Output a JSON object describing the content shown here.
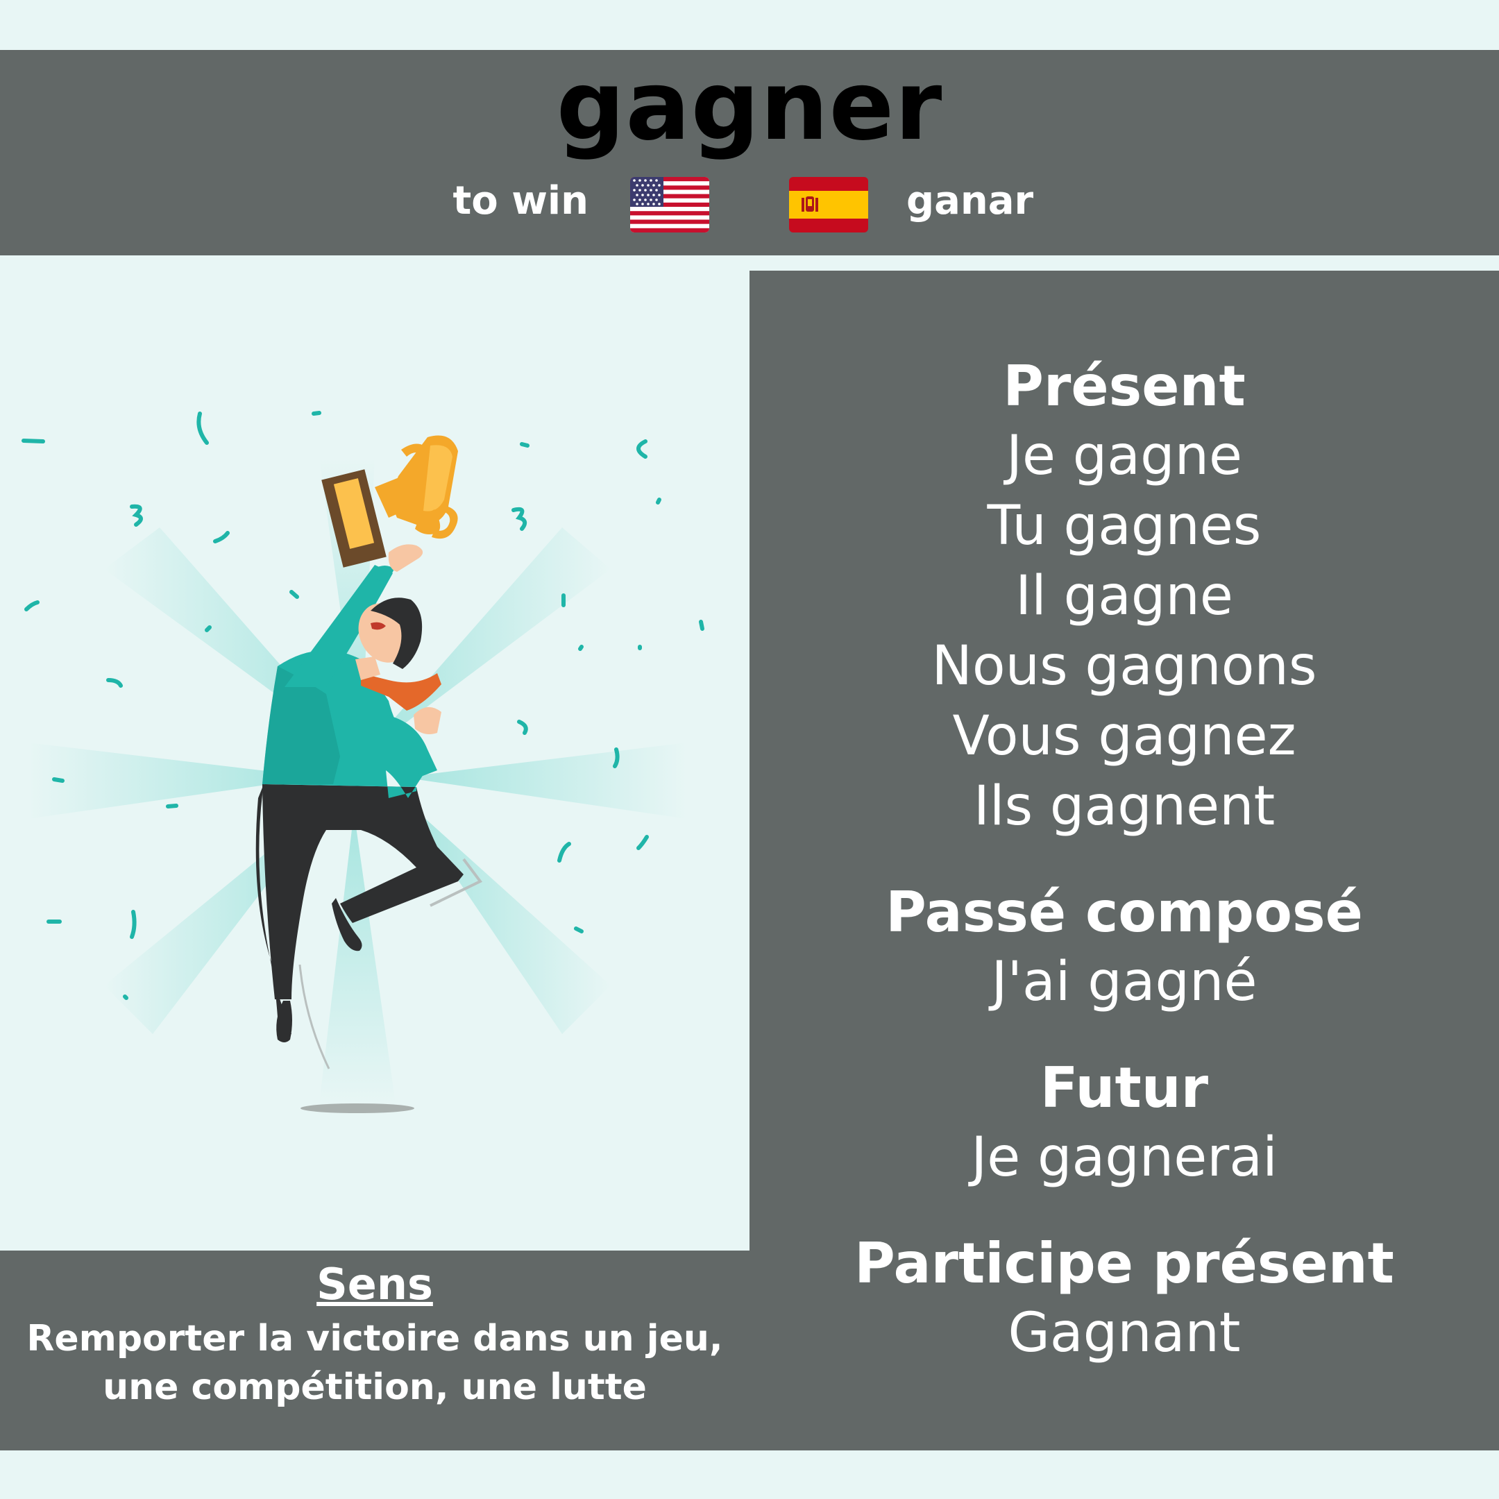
{
  "verb": "gagner",
  "translations": {
    "english": "to win",
    "spanish": "ganar"
  },
  "flags": {
    "english": "us-flag-icon",
    "spanish": "spain-flag-icon"
  },
  "tenses": [
    {
      "name": "Présent",
      "forms": [
        "Je gagne",
        "Tu gagnes",
        "Il gagne",
        "Nous gagnons",
        "Vous gagnez",
        "Ils gagnent"
      ]
    },
    {
      "name": "Passé composé",
      "forms": [
        "J'ai gagné"
      ]
    },
    {
      "name": "Futur",
      "forms": [
        "Je gagnerai"
      ]
    },
    {
      "name": "Participe présent",
      "forms": [
        "Gagnant"
      ]
    }
  ],
  "sens": {
    "title": "Sens",
    "text": "Remporter la victoire dans un jeu, une compétition, une lutte"
  },
  "colors": {
    "panel": "#626867",
    "background": "#e8f6f5",
    "accent": "#1fb5a8"
  }
}
